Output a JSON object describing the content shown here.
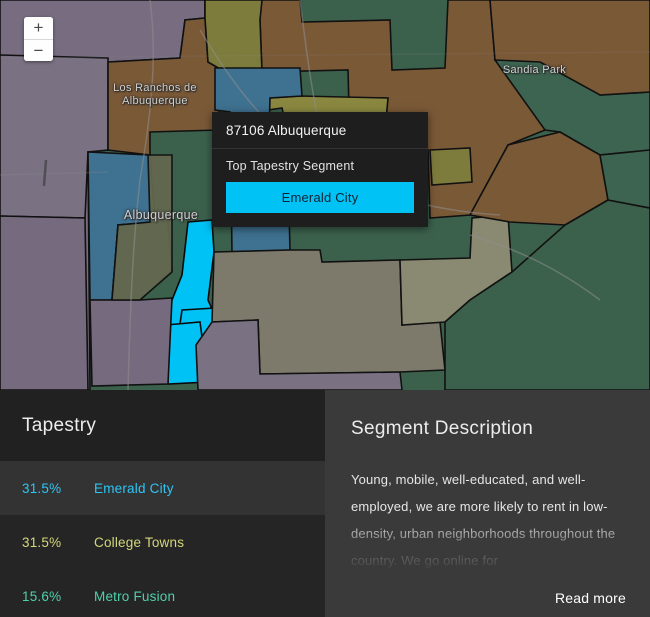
{
  "map": {
    "labels": [
      {
        "name": "los-ranchos",
        "text": "Los Ranchos de\nAlbuquerque"
      },
      {
        "name": "albuquerque",
        "text": "Albuquerque"
      },
      {
        "name": "sandia-park",
        "text": "Sandia Park"
      }
    ],
    "label_los_ranchos_line1": "Los Ranchos de",
    "label_los_ranchos_line2": "Albuquerque",
    "label_albuquerque": "Albuquerque",
    "label_sandia_park": "Sandia Park",
    "zoom_in": "+",
    "zoom_out": "−",
    "region_colors": {
      "purple_gray": "#776c80",
      "brown": "#7a5937",
      "olive": "#7e7c3c",
      "steel_blue": "#3f7190",
      "dark_green": "#3b614c",
      "sage": "#62684f",
      "tan_gray": "#7d7a6c",
      "highlight_cyan": "#00c2f5",
      "border": "#111111",
      "road": "#8d8d8d"
    }
  },
  "popup": {
    "title": "87106 Albuquerque",
    "subtitle": "Top Tapestry Segment",
    "segment": "Emerald City",
    "segment_color": "#00c2f5"
  },
  "tapestry_panel": {
    "header": "Tapestry",
    "rows": [
      {
        "pct": "31.5%",
        "name": "Emerald City",
        "color": "#2ec5f5",
        "active": true
      },
      {
        "pct": "31.5%",
        "name": "College Towns",
        "color": "#d4d77a",
        "active": false
      },
      {
        "pct": "15.6%",
        "name": "Metro Fusion",
        "color": "#4fd0a8",
        "active": false
      }
    ]
  },
  "description_panel": {
    "header": "Segment Description",
    "body": "Young, mobile, well-educated, and well-employed, we are more likely to rent in low-density, urban neighborhoods throughout the country. We go online for",
    "read_more": "Read more"
  }
}
